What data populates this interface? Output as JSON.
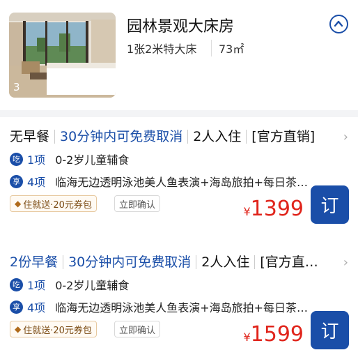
{
  "room": {
    "title": "园林景观大床房",
    "bed": "1张2米特大床",
    "area": "73㎡",
    "photo_count": "3"
  },
  "rates": [
    {
      "breakfast": "无早餐",
      "cancel": "30分钟内可免费取消",
      "guests": "2人入住",
      "channel": "[官方直销]",
      "perks": [
        {
          "icon": "吃",
          "count": "1项",
          "text": "0-2岁儿童辅食"
        },
        {
          "icon": "享",
          "count": "4项",
          "text": "临海无边透明泳池美人鱼表演+海岛旅拍+每日茶…"
        }
      ],
      "promo_tag": "住就送·20元券包",
      "confirm_tag": "立即确认",
      "currency": "¥",
      "price": "1399",
      "book_label": "订"
    },
    {
      "breakfast": "2份早餐",
      "cancel": "30分钟内可免费取消",
      "guests": "2人入住",
      "channel": "[官方直…",
      "perks": [
        {
          "icon": "吃",
          "count": "1项",
          "text": "0-2岁儿童辅食"
        },
        {
          "icon": "享",
          "count": "4项",
          "text": "临海无边透明泳池美人鱼表演+海岛旅拍+每日茶…"
        }
      ],
      "promo_tag": "住就送·20元券包",
      "confirm_tag": "立即确认",
      "currency": "¥",
      "price": "1599",
      "book_label": "订"
    }
  ],
  "colors": {
    "accent": "#1a4ea8",
    "price": "#e0241b"
  }
}
